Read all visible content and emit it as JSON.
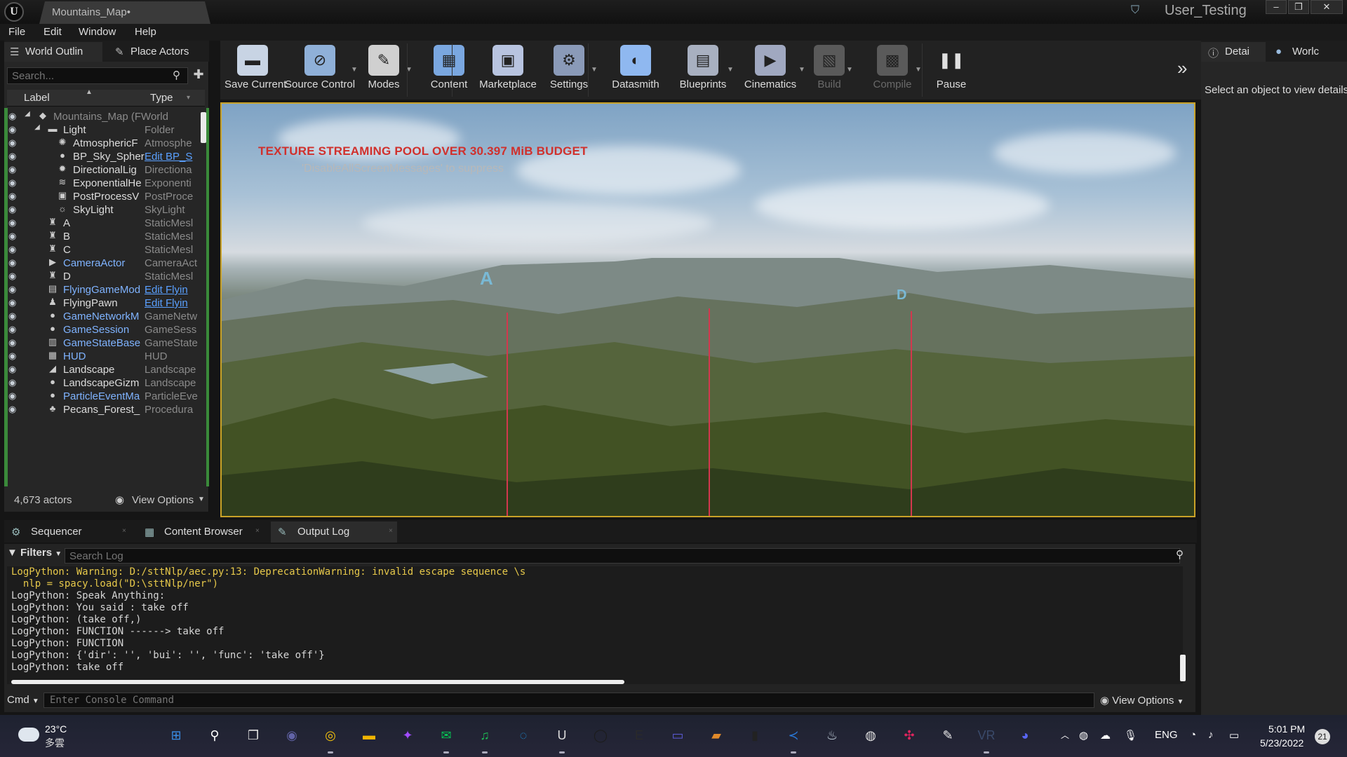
{
  "window": {
    "doc_tab": "Mountains_Map•",
    "user": "User_Testing",
    "controls": [
      "–",
      "❐",
      "✕"
    ]
  },
  "menu": [
    "File",
    "Edit",
    "Window",
    "Help"
  ],
  "outliner": {
    "tabs": [
      {
        "label": "World Outlin",
        "icon": "list-icon"
      },
      {
        "label": "Place Actors",
        "icon": "place-actors-icon"
      }
    ],
    "search_placeholder": "Search...",
    "col_label": "Label",
    "col_type": "Type",
    "rows": [
      {
        "label": "Mountains_Map (FWorld",
        "type": "",
        "indent": 0,
        "icon": "world-icon",
        "style": "dim"
      },
      {
        "label": "Light",
        "type": "Folder",
        "indent": 1,
        "icon": "folder-icon",
        "style": ""
      },
      {
        "label": "AtmosphericF",
        "type": "Atmosphe",
        "indent": 2,
        "icon": "atmosphere-icon",
        "style": ""
      },
      {
        "label": "BP_Sky_Spher",
        "type": "Edit BP_S",
        "indent": 2,
        "icon": "sphere-icon",
        "style": "",
        "link": true
      },
      {
        "label": "DirectionalLig",
        "type": "Directiona",
        "indent": 2,
        "icon": "sun-icon",
        "style": ""
      },
      {
        "label": "ExponentialHe",
        "type": "Exponenti",
        "indent": 2,
        "icon": "fog-icon",
        "style": ""
      },
      {
        "label": "PostProcessV",
        "type": "PostProce",
        "indent": 2,
        "icon": "postprocess-icon",
        "style": ""
      },
      {
        "label": "SkyLight",
        "type": "SkyLight",
        "indent": 2,
        "icon": "skylight-icon",
        "style": ""
      },
      {
        "label": "A",
        "type": "StaticMesl",
        "indent": 1,
        "icon": "static-mesh-icon",
        "style": ""
      },
      {
        "label": "B",
        "type": "StaticMesl",
        "indent": 1,
        "icon": "static-mesh-icon",
        "style": ""
      },
      {
        "label": "C",
        "type": "StaticMesl",
        "indent": 1,
        "icon": "static-mesh-icon",
        "style": ""
      },
      {
        "label": "CameraActor",
        "type": "CameraAct",
        "indent": 1,
        "icon": "camera-icon",
        "style": "blue"
      },
      {
        "label": "D",
        "type": "StaticMesl",
        "indent": 1,
        "icon": "static-mesh-icon",
        "style": ""
      },
      {
        "label": "FlyingGameMod",
        "type": "Edit Flyin",
        "indent": 1,
        "icon": "gamemode-icon",
        "style": "blue",
        "link": true
      },
      {
        "label": "FlyingPawn",
        "type": "Edit Flyin",
        "indent": 1,
        "icon": "pawn-icon",
        "style": "",
        "link": true
      },
      {
        "label": "GameNetworkM",
        "type": "GameNetw",
        "indent": 1,
        "icon": "sphere-icon",
        "style": "blue"
      },
      {
        "label": "GameSession",
        "type": "GameSess",
        "indent": 1,
        "icon": "sphere-icon",
        "style": "blue"
      },
      {
        "label": "GameStateBase",
        "type": "GameState",
        "indent": 1,
        "icon": "gamestate-icon",
        "style": "blue"
      },
      {
        "label": "HUD",
        "type": "HUD",
        "indent": 1,
        "icon": "hud-icon",
        "style": "blue"
      },
      {
        "label": "Landscape",
        "type": "Landscape",
        "indent": 1,
        "icon": "landscape-icon",
        "style": ""
      },
      {
        "label": "LandscapeGizm",
        "type": "Landscape",
        "indent": 1,
        "icon": "sphere-icon",
        "style": ""
      },
      {
        "label": "ParticleEventMa",
        "type": "ParticleEve",
        "indent": 1,
        "icon": "sphere-icon",
        "style": "blue"
      },
      {
        "label": "Pecans_Forest_",
        "type": "Procedura",
        "indent": 1,
        "icon": "foliage-icon",
        "style": ""
      }
    ],
    "actor_count": "4,673 actors",
    "view_options": "View Options"
  },
  "toolbar": [
    {
      "label": "Save Current",
      "icon": "save-icon",
      "color": "#c8d4e4",
      "caret": false,
      "disabled": false
    },
    {
      "label": "Source Control",
      "icon": "source-control-icon",
      "color": "#8fb0d8",
      "caret": true,
      "disabled": false
    },
    {
      "label": "Modes",
      "icon": "modes-icon",
      "color": "#d0d0d0",
      "caret": true,
      "disabled": false
    },
    {
      "label": "Content",
      "icon": "content-icon",
      "color": "#7aa7e0",
      "caret": false,
      "disabled": false
    },
    {
      "label": "Marketplace",
      "icon": "marketplace-icon",
      "color": "#b8c4e0",
      "caret": false,
      "disabled": false
    },
    {
      "label": "Settings",
      "icon": "settings-icon",
      "color": "#8a9ab8",
      "caret": true,
      "disabled": false
    },
    {
      "label": "Datasmith",
      "icon": "datasmith-icon",
      "color": "#8fb8f0",
      "caret": false,
      "disabled": false
    },
    {
      "label": "Blueprints",
      "icon": "blueprints-icon",
      "color": "#a8b0c0",
      "caret": true,
      "disabled": false
    },
    {
      "label": "Cinematics",
      "icon": "cinematics-icon",
      "color": "#a0a8c0",
      "caret": true,
      "disabled": false
    },
    {
      "label": "Build",
      "icon": "build-icon",
      "color": "#5a5a5a",
      "caret": true,
      "disabled": true
    },
    {
      "label": "Compile",
      "icon": "compile-icon",
      "color": "#5a5a5a",
      "caret": true,
      "disabled": true
    },
    {
      "label": "Pause",
      "icon": "pause-icon",
      "color": "#e0e0e0",
      "caret": false,
      "disabled": false
    }
  ],
  "viewport": {
    "warning": "TEXTURE STREAMING POOL OVER 30.397 MiB BUDGET",
    "suppress_hint": "'DisableAllScreenMessages' to suppress",
    "markers": [
      "A",
      "D"
    ]
  },
  "details": {
    "tabs": [
      "Detai",
      "Worlc"
    ],
    "message": "Select an object to view details."
  },
  "bottom_tabs": [
    {
      "label": "Sequencer",
      "icon": "sequencer-icon"
    },
    {
      "label": "Content Browser",
      "icon": "content-browser-icon"
    },
    {
      "label": "Output Log",
      "icon": "output-log-icon"
    }
  ],
  "log": {
    "filters": "Filters",
    "search_placeholder": "Search Log",
    "lines": [
      {
        "text": "LogPython: Warning: D:/sttNlp/aec.py:13: DeprecationWarning: invalid escape sequence \\s",
        "level": "warn"
      },
      {
        "text": "  nlp = spacy.load(\"D:\\sttNlp/ner\")",
        "level": "warn"
      },
      {
        "text": "LogPython: Speak Anything:",
        "level": ""
      },
      {
        "text": "LogPython: You said : take off",
        "level": ""
      },
      {
        "text": "LogPython: (take off,)",
        "level": ""
      },
      {
        "text": "LogPython: FUNCTION ------> take off",
        "level": ""
      },
      {
        "text": "LogPython: FUNCTION",
        "level": ""
      },
      {
        "text": "LogPython: {'dir': '', 'bui': '', 'func': 'take off'}",
        "level": ""
      },
      {
        "text": "LogPython: take off",
        "level": ""
      }
    ],
    "cmd_label": "Cmd",
    "cmd_placeholder": "Enter Console Command",
    "view_options": "View Options"
  },
  "taskbar": {
    "temp": "23°C",
    "weather": "多雲",
    "apps": [
      "windows-start-icon",
      "search-icon",
      "task-view-icon",
      "teams-icon",
      "chrome-icon",
      "file-explorer-icon",
      "messenger-icon",
      "line-icon",
      "spotify-icon",
      "edge-icon",
      "unreal-icon",
      "obs-icon",
      "epic-games-icon",
      "oculus-icon",
      "folder-app-icon",
      "terminal-icon",
      "vscode-icon",
      "steam-icon",
      "github-icon",
      "game-app-icon",
      "notepad-icon",
      "vr-icon",
      "discord-icon"
    ],
    "lang": "ENG",
    "time": "5:01 PM",
    "date": "5/23/2022",
    "notifications": "21"
  }
}
